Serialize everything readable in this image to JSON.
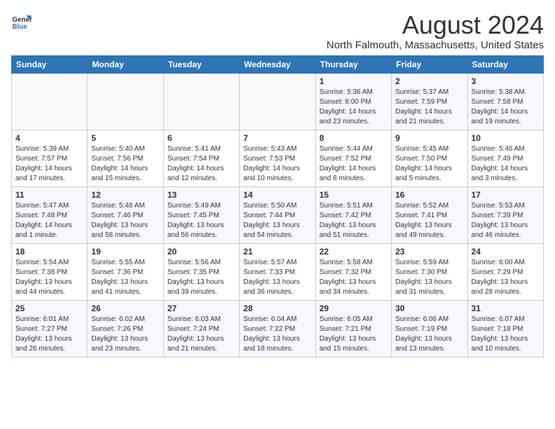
{
  "header": {
    "logo_general": "General",
    "logo_blue": "Blue",
    "title": "August 2024",
    "subtitle": "North Falmouth, Massachusetts, United States"
  },
  "days_of_week": [
    "Sunday",
    "Monday",
    "Tuesday",
    "Wednesday",
    "Thursday",
    "Friday",
    "Saturday"
  ],
  "weeks": [
    [
      {
        "day": "",
        "content": ""
      },
      {
        "day": "",
        "content": ""
      },
      {
        "day": "",
        "content": ""
      },
      {
        "day": "",
        "content": ""
      },
      {
        "day": "1",
        "content": "Sunrise: 5:36 AM\nSunset: 8:00 PM\nDaylight: 14 hours\nand 23 minutes."
      },
      {
        "day": "2",
        "content": "Sunrise: 5:37 AM\nSunset: 7:59 PM\nDaylight: 14 hours\nand 21 minutes."
      },
      {
        "day": "3",
        "content": "Sunrise: 5:38 AM\nSunset: 7:58 PM\nDaylight: 14 hours\nand 19 minutes."
      }
    ],
    [
      {
        "day": "4",
        "content": "Sunrise: 5:39 AM\nSunset: 7:57 PM\nDaylight: 14 hours\nand 17 minutes."
      },
      {
        "day": "5",
        "content": "Sunrise: 5:40 AM\nSunset: 7:56 PM\nDaylight: 14 hours\nand 15 minutes."
      },
      {
        "day": "6",
        "content": "Sunrise: 5:41 AM\nSunset: 7:54 PM\nDaylight: 14 hours\nand 12 minutes."
      },
      {
        "day": "7",
        "content": "Sunrise: 5:43 AM\nSunset: 7:53 PM\nDaylight: 14 hours\nand 10 minutes."
      },
      {
        "day": "8",
        "content": "Sunrise: 5:44 AM\nSunset: 7:52 PM\nDaylight: 14 hours\nand 8 minutes."
      },
      {
        "day": "9",
        "content": "Sunrise: 5:45 AM\nSunset: 7:50 PM\nDaylight: 14 hours\nand 5 minutes."
      },
      {
        "day": "10",
        "content": "Sunrise: 5:46 AM\nSunset: 7:49 PM\nDaylight: 14 hours\nand 3 minutes."
      }
    ],
    [
      {
        "day": "11",
        "content": "Sunrise: 5:47 AM\nSunset: 7:48 PM\nDaylight: 14 hours\nand 1 minute."
      },
      {
        "day": "12",
        "content": "Sunrise: 5:48 AM\nSunset: 7:46 PM\nDaylight: 13 hours\nand 58 minutes."
      },
      {
        "day": "13",
        "content": "Sunrise: 5:49 AM\nSunset: 7:45 PM\nDaylight: 13 hours\nand 56 minutes."
      },
      {
        "day": "14",
        "content": "Sunrise: 5:50 AM\nSunset: 7:44 PM\nDaylight: 13 hours\nand 54 minutes."
      },
      {
        "day": "15",
        "content": "Sunrise: 5:51 AM\nSunset: 7:42 PM\nDaylight: 13 hours\nand 51 minutes."
      },
      {
        "day": "16",
        "content": "Sunrise: 5:52 AM\nSunset: 7:41 PM\nDaylight: 13 hours\nand 49 minutes."
      },
      {
        "day": "17",
        "content": "Sunrise: 5:53 AM\nSunset: 7:39 PM\nDaylight: 13 hours\nand 46 minutes."
      }
    ],
    [
      {
        "day": "18",
        "content": "Sunrise: 5:54 AM\nSunset: 7:38 PM\nDaylight: 13 hours\nand 44 minutes."
      },
      {
        "day": "19",
        "content": "Sunrise: 5:55 AM\nSunset: 7:36 PM\nDaylight: 13 hours\nand 41 minutes."
      },
      {
        "day": "20",
        "content": "Sunrise: 5:56 AM\nSunset: 7:35 PM\nDaylight: 13 hours\nand 39 minutes."
      },
      {
        "day": "21",
        "content": "Sunrise: 5:57 AM\nSunset: 7:33 PM\nDaylight: 13 hours\nand 36 minutes."
      },
      {
        "day": "22",
        "content": "Sunrise: 5:58 AM\nSunset: 7:32 PM\nDaylight: 13 hours\nand 34 minutes."
      },
      {
        "day": "23",
        "content": "Sunrise: 5:59 AM\nSunset: 7:30 PM\nDaylight: 13 hours\nand 31 minutes."
      },
      {
        "day": "24",
        "content": "Sunrise: 6:00 AM\nSunset: 7:29 PM\nDaylight: 13 hours\nand 28 minutes."
      }
    ],
    [
      {
        "day": "25",
        "content": "Sunrise: 6:01 AM\nSunset: 7:27 PM\nDaylight: 13 hours\nand 26 minutes."
      },
      {
        "day": "26",
        "content": "Sunrise: 6:02 AM\nSunset: 7:26 PM\nDaylight: 13 hours\nand 23 minutes."
      },
      {
        "day": "27",
        "content": "Sunrise: 6:03 AM\nSunset: 7:24 PM\nDaylight: 13 hours\nand 21 minutes."
      },
      {
        "day": "28",
        "content": "Sunrise: 6:04 AM\nSunset: 7:22 PM\nDaylight: 13 hours\nand 18 minutes."
      },
      {
        "day": "29",
        "content": "Sunrise: 6:05 AM\nSunset: 7:21 PM\nDaylight: 13 hours\nand 15 minutes."
      },
      {
        "day": "30",
        "content": "Sunrise: 6:06 AM\nSunset: 7:19 PM\nDaylight: 13 hours\nand 13 minutes."
      },
      {
        "day": "31",
        "content": "Sunrise: 6:07 AM\nSunset: 7:18 PM\nDaylight: 13 hours\nand 10 minutes."
      }
    ]
  ]
}
